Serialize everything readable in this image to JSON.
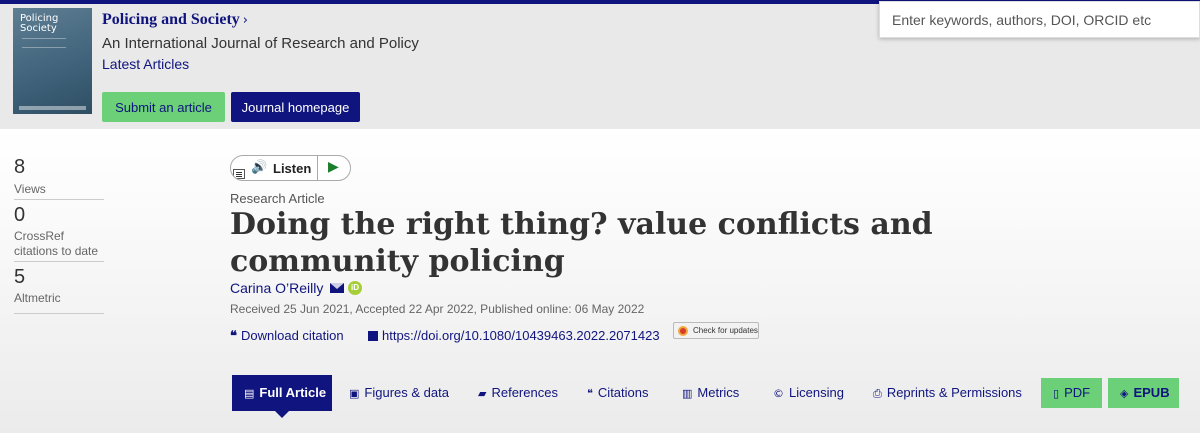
{
  "journal": {
    "cover_title": "Policing\nSociety",
    "title": "Policing and Society",
    "chevron": "›",
    "subtitle": "An International Journal of Research and Policy",
    "latest_link": "Latest Articles",
    "submit_label": "Submit an article",
    "homepage_label": "Journal homepage"
  },
  "search": {
    "placeholder": "Enter keywords, authors, DOI, ORCID etc"
  },
  "metrics": [
    {
      "value": "8",
      "label": "Views"
    },
    {
      "value": "0",
      "label": "CrossRef citations to date"
    },
    {
      "value": "5",
      "label": "Altmetric"
    }
  ],
  "listen": {
    "label": "Listen",
    "speaker_icon": "🔊",
    "play_icon": "▶"
  },
  "article": {
    "type": "Research Article",
    "title": "Doing the right thing? value conflicts and community policing",
    "author": "Carina O’Reilly",
    "orcid_text": "iD",
    "dates": "Received 25 Jun 2021, Accepted 22 Apr 2022, Published online: 06 May 2022",
    "download_citation": "Download citation",
    "doi": "https://doi.org/10.1080/10439463.2022.2071423",
    "check_updates": "Check for updates"
  },
  "tabs": {
    "full_article": "Full Article",
    "figures": "Figures & data",
    "references": "References",
    "citations": "Citations",
    "metrics": "Metrics",
    "licensing": "Licensing",
    "reprints": "Reprints & Permissions",
    "pdf": "PDF",
    "epub": "EPUB"
  },
  "colors": {
    "brand_navy": "#10147e",
    "accent_green": "#6bd078"
  }
}
